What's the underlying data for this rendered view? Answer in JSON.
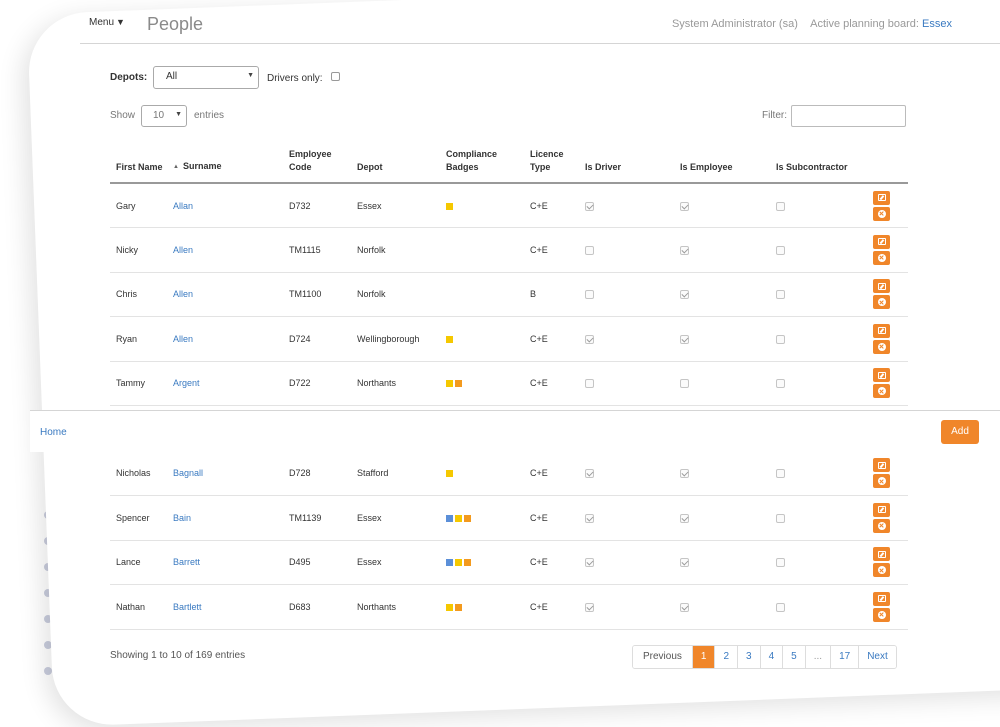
{
  "header": {
    "menu_label": "Menu",
    "page_title": "People",
    "user_label": "System Administrator (sa)",
    "board_prefix": "Active planning board:",
    "board_name": "Essex"
  },
  "filters": {
    "depots_label": "Depots:",
    "depots_value": "All",
    "drivers_only_label": "Drivers only:",
    "drivers_only_checked": false
  },
  "length": {
    "show_label": "Show",
    "value": "10",
    "entries_label": "entries",
    "filter_label": "Filter:"
  },
  "table": {
    "columns": [
      "First Name",
      "Surname",
      "Employee Code",
      "Depot",
      "Compliance Badges",
      "Licence Type",
      "Is Driver",
      "Is Employee",
      "Is Subcontractor"
    ],
    "rows_top": [
      {
        "first": "Gary",
        "surname": "Allan",
        "code": "D732",
        "depot": "Essex",
        "badges": [
          "yellow"
        ],
        "licence": "C+E",
        "driver": true,
        "employee": true,
        "sub": false
      },
      {
        "first": "Nicky",
        "surname": "Allen",
        "code": "TM1115",
        "depot": "Norfolk",
        "badges": [],
        "licence": "C+E",
        "driver": false,
        "employee": true,
        "sub": false
      },
      {
        "first": "Chris",
        "surname": "Allen",
        "code": "TM1100",
        "depot": "Norfolk",
        "badges": [],
        "licence": "B",
        "driver": false,
        "employee": true,
        "sub": false
      },
      {
        "first": "Ryan",
        "surname": "Allen",
        "code": "D724",
        "depot": "Wellingborough",
        "badges": [
          "yellow"
        ],
        "licence": "C+E",
        "driver": true,
        "employee": true,
        "sub": false
      },
      {
        "first": "Tammy",
        "surname": "Argent",
        "code": "D722",
        "depot": "Northants",
        "badges": [
          "yellow",
          "orange"
        ],
        "licence": "C+E",
        "driver": false,
        "employee": false,
        "sub": false
      }
    ],
    "rows_bottom": [
      {
        "first": "Nicholas",
        "surname": "Bagnall",
        "code": "D728",
        "depot": "Stafford",
        "badges": [
          "yellow"
        ],
        "licence": "C+E",
        "driver": true,
        "employee": true,
        "sub": false
      },
      {
        "first": "Spencer",
        "surname": "Bain",
        "code": "TM1139",
        "depot": "Essex",
        "badges": [
          "blue",
          "yellow",
          "orange"
        ],
        "licence": "C+E",
        "driver": true,
        "employee": true,
        "sub": false
      },
      {
        "first": "Lance",
        "surname": "Barrett",
        "code": "D495",
        "depot": "Essex",
        "badges": [
          "blue",
          "yellow",
          "orange"
        ],
        "licence": "C+E",
        "driver": true,
        "employee": true,
        "sub": false
      },
      {
        "first": "Nathan",
        "surname": "Bartlett",
        "code": "D683",
        "depot": "Northants",
        "badges": [
          "yellow",
          "orange"
        ],
        "licence": "C+E",
        "driver": true,
        "employee": true,
        "sub": false
      }
    ]
  },
  "badge_colors": {
    "yellow": "#f5c800",
    "orange": "#f39a1e",
    "blue": "#5b8fd8"
  },
  "footer_bar": {
    "home_label": "Home",
    "add_label": "Add"
  },
  "info": "Showing 1 to 10 of 169 entries",
  "pagination": {
    "previous": "Previous",
    "pages": [
      "1",
      "2",
      "3",
      "4",
      "5",
      "...",
      "17"
    ],
    "active": "1",
    "next": "Next"
  },
  "accent_color": "#f0862a"
}
